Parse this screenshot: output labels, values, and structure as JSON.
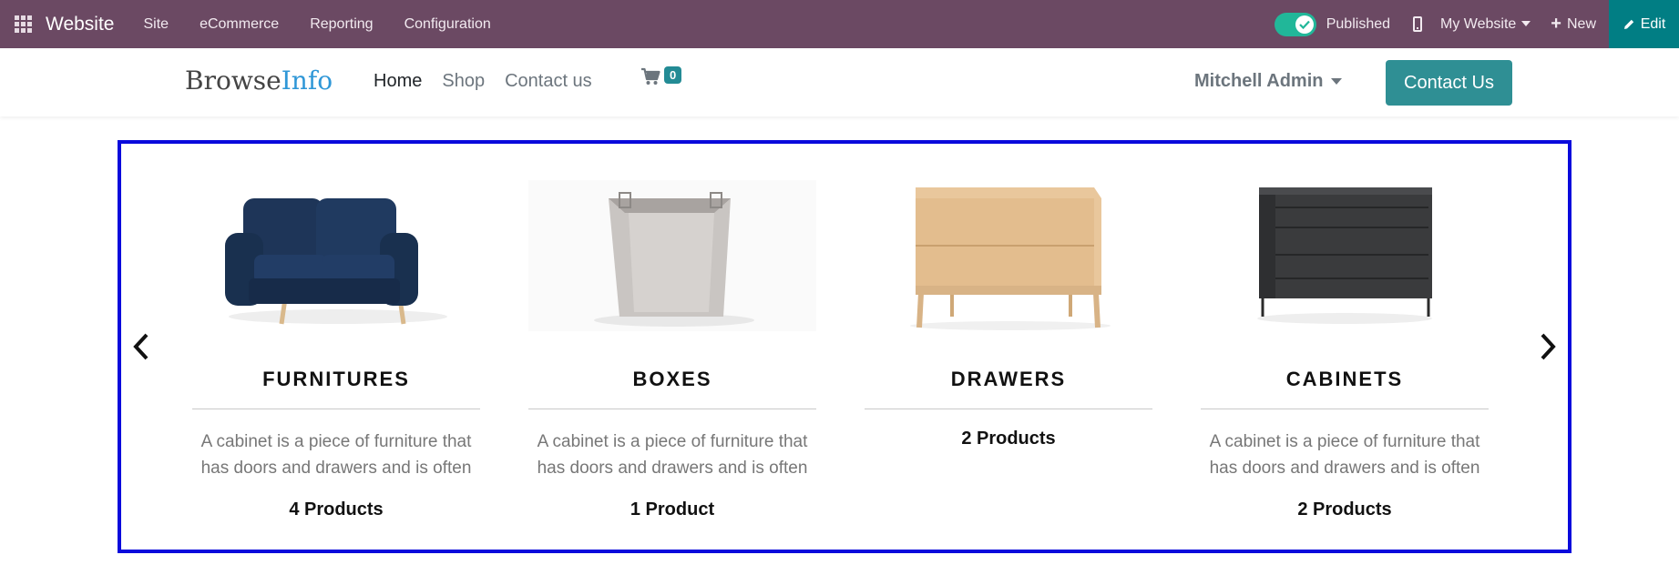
{
  "adminbar": {
    "brand": "Website",
    "menus": [
      "Site",
      "eCommerce",
      "Reporting",
      "Configuration"
    ],
    "published_label": "Published",
    "website_label": "My Website",
    "new_label": "New",
    "edit_label": "Edit"
  },
  "header": {
    "logo_part1": "Browse",
    "logo_part2": "Info",
    "nav": [
      "Home",
      "Shop",
      "Contact us"
    ],
    "cart_count": "0",
    "user_name": "Mitchell Admin",
    "contact_button": "Contact Us"
  },
  "colors": {
    "adminbar_bg": "#6b4963",
    "edit_bg": "#017e84",
    "accent": "#2f8f94",
    "carousel_border": "#0a0adc"
  },
  "carousel": {
    "cards": [
      {
        "title": "FURNITURES",
        "description": "A cabinet is a piece of furniture that has doors and drawers and is often",
        "count": "4 Products"
      },
      {
        "title": "BOXES",
        "description": "A cabinet is a piece of furniture that has doors and drawers and is often",
        "count": "1 Product"
      },
      {
        "title": "DRAWERS",
        "description": "",
        "count": "2 Products"
      },
      {
        "title": "CABINETS",
        "description": "A cabinet is a piece of furniture that has doors and drawers and is often",
        "count": "2 Products"
      }
    ]
  }
}
